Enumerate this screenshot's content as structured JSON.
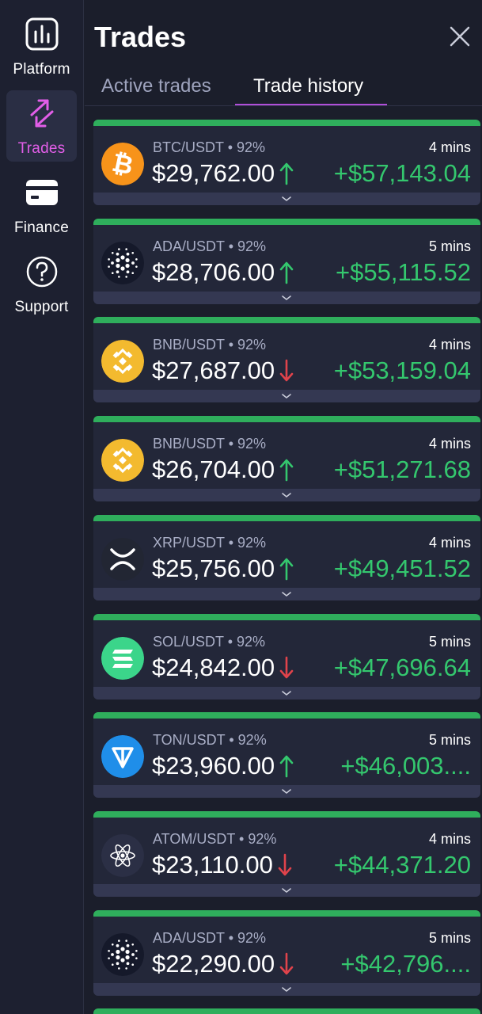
{
  "sidebar": {
    "items": [
      {
        "label": "Platform",
        "icon": "chart-bars-icon",
        "active": false
      },
      {
        "label": "Trades",
        "icon": "swap-arrows-icon",
        "active": true
      },
      {
        "label": "Finance",
        "icon": "card-icon",
        "active": false
      },
      {
        "label": "Support",
        "icon": "question-circle-icon",
        "active": false
      }
    ]
  },
  "header": {
    "title": "Trades",
    "close_icon": "close-icon"
  },
  "tabs": [
    {
      "label": "Active trades",
      "active": false
    },
    {
      "label": "Trade history",
      "active": true
    }
  ],
  "colors": {
    "accent": "#b04ed8",
    "profit": "#34c76e",
    "down": "#e0434b",
    "card_bar": "#2fae5c"
  },
  "trades": [
    {
      "coin": "btc",
      "pair": "BTC/USDT",
      "percent": "92%",
      "time": "4 mins",
      "price": "$29,762.00",
      "direction": "up",
      "profit": "+$57,143.04"
    },
    {
      "coin": "ada",
      "pair": "ADA/USDT",
      "percent": "92%",
      "time": "5 mins",
      "price": "$28,706.00",
      "direction": "up",
      "profit": "+$55,115.52"
    },
    {
      "coin": "bnb",
      "pair": "BNB/USDT",
      "percent": "92%",
      "time": "4 mins",
      "price": "$27,687.00",
      "direction": "down",
      "profit": "+$53,159.04"
    },
    {
      "coin": "bnb",
      "pair": "BNB/USDT",
      "percent": "92%",
      "time": "4 mins",
      "price": "$26,704.00",
      "direction": "up",
      "profit": "+$51,271.68"
    },
    {
      "coin": "xrp",
      "pair": "XRP/USDT",
      "percent": "92%",
      "time": "4 mins",
      "price": "$25,756.00",
      "direction": "up",
      "profit": "+$49,451.52"
    },
    {
      "coin": "sol",
      "pair": "SOL/USDT",
      "percent": "92%",
      "time": "5 mins",
      "price": "$24,842.00",
      "direction": "down",
      "profit": "+$47,696.64"
    },
    {
      "coin": "ton",
      "pair": "TON/USDT",
      "percent": "92%",
      "time": "5 mins",
      "price": "$23,960.00",
      "direction": "up",
      "profit": "+$46,003...."
    },
    {
      "coin": "atom",
      "pair": "ATOM/USDT",
      "percent": "92%",
      "time": "4 mins",
      "price": "$23,110.00",
      "direction": "down",
      "profit": "+$44,371.20"
    },
    {
      "coin": "ada",
      "pair": "ADA/USDT",
      "percent": "92%",
      "time": "5 mins",
      "price": "$22,290.00",
      "direction": "down",
      "profit": "+$42,796...."
    }
  ]
}
